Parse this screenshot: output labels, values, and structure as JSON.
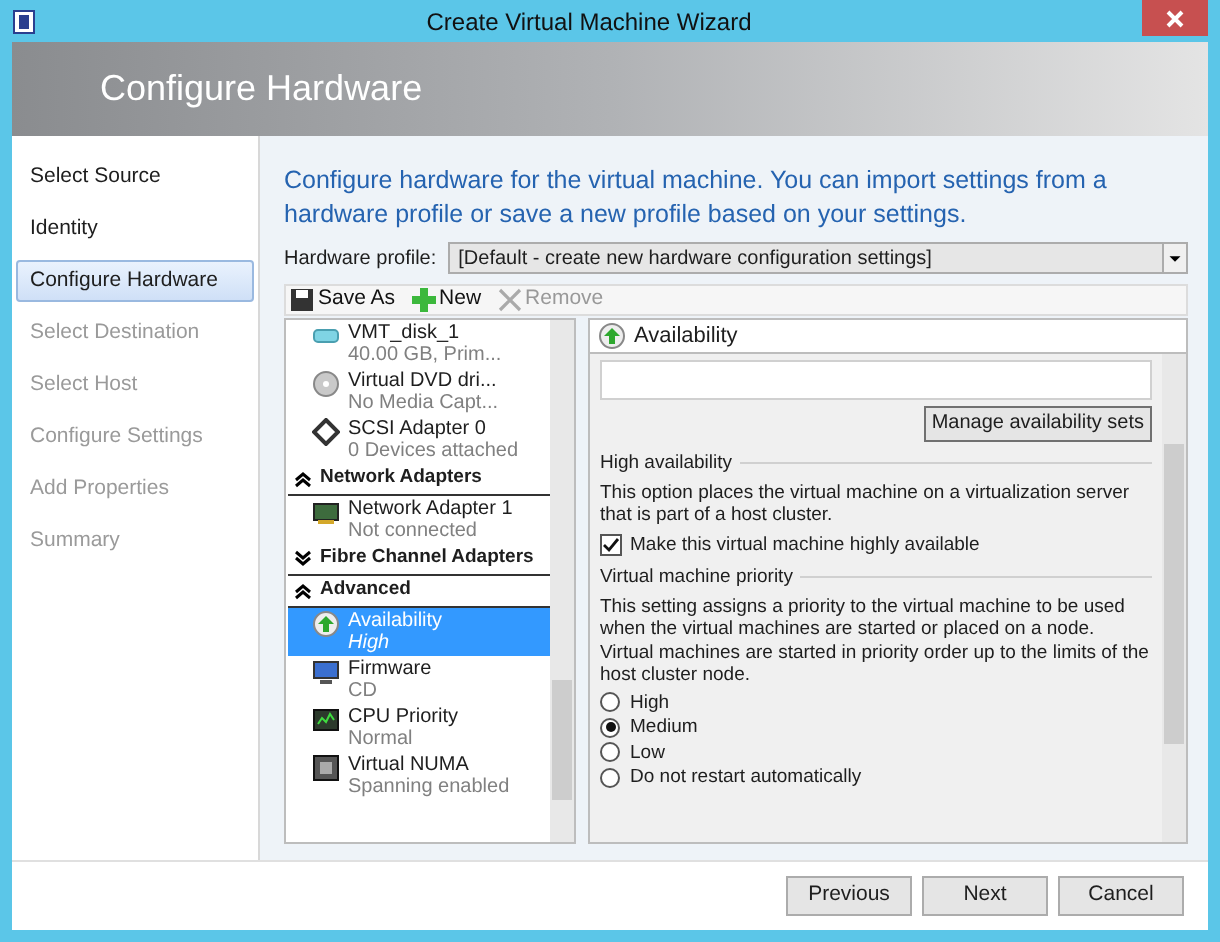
{
  "window": {
    "title": "Create Virtual Machine Wizard"
  },
  "header": {
    "title": "Configure Hardware"
  },
  "steps": [
    {
      "label": "Select Source",
      "selected": false,
      "enabled": true
    },
    {
      "label": "Identity",
      "selected": false,
      "enabled": true
    },
    {
      "label": "Configure Hardware",
      "selected": true,
      "enabled": true
    },
    {
      "label": "Select Destination",
      "selected": false,
      "enabled": false
    },
    {
      "label": "Select Host",
      "selected": false,
      "enabled": false
    },
    {
      "label": "Configure Settings",
      "selected": false,
      "enabled": false
    },
    {
      "label": "Add Properties",
      "selected": false,
      "enabled": false
    },
    {
      "label": "Summary",
      "selected": false,
      "enabled": false
    }
  ],
  "intro": "Configure hardware for the virtual machine. You can import settings from a hardware profile or save a new profile based on your settings.",
  "hardware_profile": {
    "label": "Hardware profile:",
    "value": "[Default - create new hardware configuration settings]"
  },
  "toolbar": [
    {
      "kind": "save",
      "label": "Save As",
      "disabled": false
    },
    {
      "kind": "new",
      "label": "New",
      "disabled": false
    },
    {
      "kind": "remove",
      "label": "Remove",
      "disabled": true
    }
  ],
  "tree": [
    {
      "kind": "disk",
      "name": "VMT_disk_1",
      "detail": "40.00 GB, Prim...",
      "selected": false
    },
    {
      "kind": "dvd",
      "name": "Virtual DVD dri...",
      "detail": "No Media Capt...",
      "selected": false
    },
    {
      "kind": "scsi",
      "name": "SCSI Adapter 0",
      "detail": "0 Devices attached",
      "selected": false
    },
    {
      "kind": "category",
      "name": "Network Adapters",
      "expanded": true
    },
    {
      "kind": "network",
      "name": "Network Adapter 1",
      "detail": "Not connected",
      "selected": false
    },
    {
      "kind": "category",
      "name": "Fibre Channel Adapters",
      "expanded": false
    },
    {
      "kind": "category",
      "name": "Advanced",
      "expanded": true
    },
    {
      "kind": "availability",
      "name": "Availability",
      "detail": "High",
      "selected": true
    },
    {
      "kind": "firmware",
      "name": "Firmware",
      "detail": "CD",
      "selected": false
    },
    {
      "kind": "cpu",
      "name": "CPU Priority",
      "detail": "Normal",
      "selected": false
    },
    {
      "kind": "numa",
      "name": "Virtual NUMA",
      "detail": "Spanning enabled",
      "selected": false
    }
  ],
  "detail": {
    "title": "Availability",
    "manage_button": "Manage availability sets",
    "high_availability": {
      "heading": "High availability",
      "text": "This option places the virtual machine on a virtualization server that is part of a host cluster.",
      "checkbox": {
        "label": "Make this virtual machine highly available",
        "checked": true
      }
    },
    "priority": {
      "heading": "Virtual machine priority",
      "text": "This setting assigns a priority to the virtual machine to be used when the virtual machines are started or placed on a node. Virtual machines are started in priority order up to the limits of the host cluster node.",
      "options": [
        {
          "label": "High",
          "selected": false
        },
        {
          "label": "Medium",
          "selected": true
        },
        {
          "label": "Low",
          "selected": false
        },
        {
          "label": "Do not restart automatically",
          "selected": false
        }
      ]
    }
  },
  "buttons": [
    {
      "label": "Previous"
    },
    {
      "label": "Next"
    },
    {
      "label": "Cancel"
    }
  ]
}
